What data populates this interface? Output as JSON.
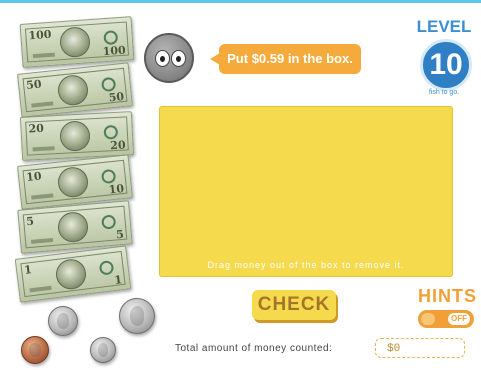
{
  "bills": [
    {
      "id": "hundred",
      "denomination": "100"
    },
    {
      "id": "fifty",
      "denomination": "50"
    },
    {
      "id": "twenty",
      "denomination": "20"
    },
    {
      "id": "ten",
      "denomination": "10"
    },
    {
      "id": "five",
      "denomination": "5"
    },
    {
      "id": "one",
      "denomination": "1"
    }
  ],
  "coins": [
    "nickel",
    "quarter",
    "penny",
    "dime"
  ],
  "prompt": "Put $0.59 in the box.",
  "level": {
    "label": "LEVEL 1",
    "number": "10",
    "subtitle": "fish to go."
  },
  "dropbox": {
    "hint": "Drag money out of the box to remove it."
  },
  "check_label": "CHECK",
  "hints": {
    "label": "HINTS",
    "toggle_state": "OFF"
  },
  "total": {
    "label": "Total amount of money counted:",
    "value": "$0"
  },
  "colors": {
    "accent_blue": "#2f7fc5",
    "bubble": "#f5ab3b",
    "box": "#f5da4d",
    "hints": "#f0a037"
  }
}
